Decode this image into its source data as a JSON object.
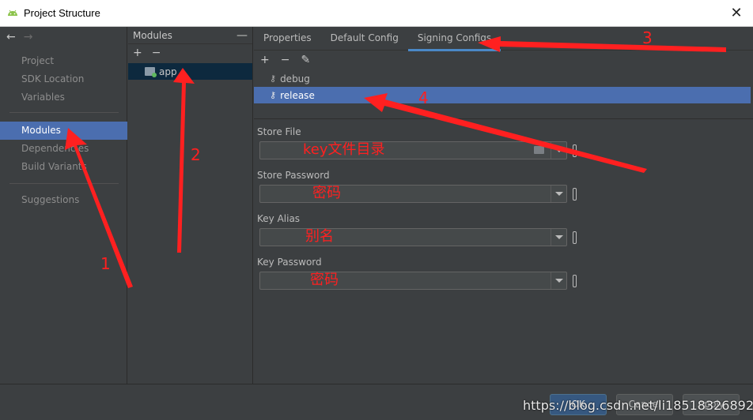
{
  "window": {
    "title": "Project Structure",
    "close_glyph": "✕",
    "icon": "android-icon"
  },
  "nav": {
    "back_glyph": "←",
    "forward_glyph": "→",
    "items": [
      {
        "label": "Project",
        "selected": false
      },
      {
        "label": "SDK Location",
        "selected": false
      },
      {
        "label": "Variables",
        "selected": false
      },
      {
        "label": "Modules",
        "selected": true
      },
      {
        "label": "Dependencies",
        "selected": false
      },
      {
        "label": "Build Variants",
        "selected": false
      },
      {
        "label": "Suggestions",
        "selected": false
      }
    ]
  },
  "modules": {
    "header": "Modules",
    "collapse_glyph": "—",
    "add_glyph": "+",
    "remove_glyph": "−",
    "items": [
      {
        "label": "app",
        "selected": true
      }
    ]
  },
  "main": {
    "tabs": [
      {
        "label": "Properties",
        "active": false
      },
      {
        "label": "Default Config",
        "active": false
      },
      {
        "label": "Signing Configs",
        "active": true
      }
    ],
    "toolbar": {
      "add_glyph": "+",
      "remove_glyph": "−",
      "edit_glyph": "✎"
    },
    "configs": [
      {
        "label": "debug",
        "selected": false
      },
      {
        "label": "release",
        "selected": true
      }
    ],
    "fields": [
      {
        "label": "Store File",
        "value": "",
        "annotation": "key文件目录",
        "has_browse": true
      },
      {
        "label": "Store Password",
        "value": "",
        "annotation": "密码",
        "has_browse": false
      },
      {
        "label": "Key Alias",
        "value": "",
        "annotation": "别名",
        "has_browse": false
      },
      {
        "label": "Key Password",
        "value": "",
        "annotation": "密码",
        "has_browse": false
      }
    ]
  },
  "footer": {
    "ok_label": "OK",
    "cancel_label": "Cancel",
    "apply_label": "Apply",
    "watermark": "https://blog.csdn.net/li18518326892"
  },
  "annotations": {
    "steps": [
      "1",
      "2",
      "3",
      "4"
    ],
    "color": "#ff2020"
  },
  "colors": {
    "selection": "#4b6eaf",
    "module_selection": "#0d293e",
    "tab_underline": "#4a88c7",
    "annotation_red": "#ff2020"
  }
}
